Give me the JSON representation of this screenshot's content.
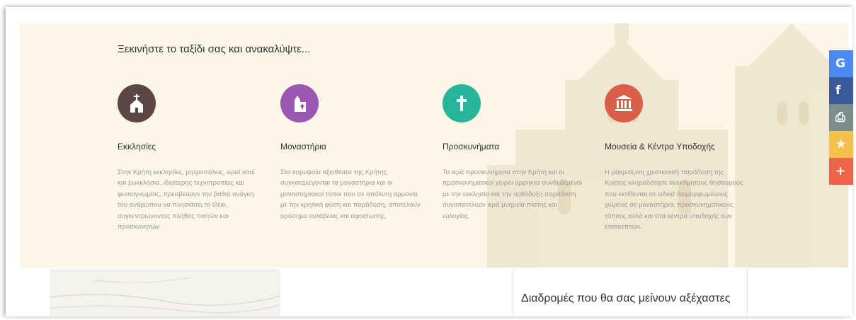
{
  "intro": "Ξεκινήστε το ταξίδι σας και ανακαλύψτε...",
  "cards": [
    {
      "icon": "church-icon",
      "color": "#5b4742",
      "title": "Εκκλησίες",
      "text": "Στην Κρήτη εκκλησίες, μητροπόλεις, ιεροί ναοί και ξωκκλήσια, ιδιαίτερης τεχνοτροπίας και φυσιογνωμίας, πρεσβεύουν την βαθιά ανάγκη του ανθρώπου να πλησιάσει το Θείο, συγκεντρωνοντας πλήθος πιστών και προσκυνητών."
    },
    {
      "icon": "monastery-icon",
      "color": "#9a56b0",
      "title": "Μοναστήρια",
      "text": "Στα κορυφαία αξιοθέατα της Κρήτης συγκαταλέγονται τα μοναστήρια και οι μοναστηριακοί τόποι που σε απόλυτη αρμονία με την κρητική φύση και παράδοση, αποτελούν ορόσημα ευλάβειας και αφοσίωσης."
    },
    {
      "icon": "cross-icon",
      "color": "#26b49a",
      "title": "Προσκυνήματα",
      "text": "Τα ιερά προσκυνήματα στην Κρήτη και οι προσκυνηματικοί χώροι άρρηκτα συνδεδεμένοι με την εκκλησία και την ορθόδοξη παράδοση συναποτελούν ιερά μνημεία πίστης και ευλογίας."
    },
    {
      "icon": "museum-icon",
      "color": "#d95f48",
      "title": "Μουσεία & Κέντρα Υποδοχής",
      "text": "Η μακραίωνη χριστιανική παράδοση της Κρήτης κληροδότησε ανεκτίμητους θησαυρούς που εκτίθενται σε ειδικά διαμορφωμένους χώρους σε μοναστήρια, προσκυνηματικούς τόπους αλλά και στα κέντρα υποδοχής των επισκεπτών."
    }
  ],
  "share": [
    {
      "icon": "google-icon",
      "glyph": "G",
      "color": "#4d89f2"
    },
    {
      "icon": "facebook-icon",
      "glyph": "f",
      "color": "#3b5998"
    },
    {
      "icon": "print-icon",
      "glyph": "⎙",
      "color": "#7c8e8b"
    },
    {
      "icon": "favorite-star-icon",
      "glyph": "★",
      "color": "#f3c04d"
    },
    {
      "icon": "more-share-plus-icon",
      "glyph": "+",
      "color": "#f0644c"
    }
  ],
  "routes_title": "Διαδρομές που θα σας μείνουν αξέχαστες"
}
